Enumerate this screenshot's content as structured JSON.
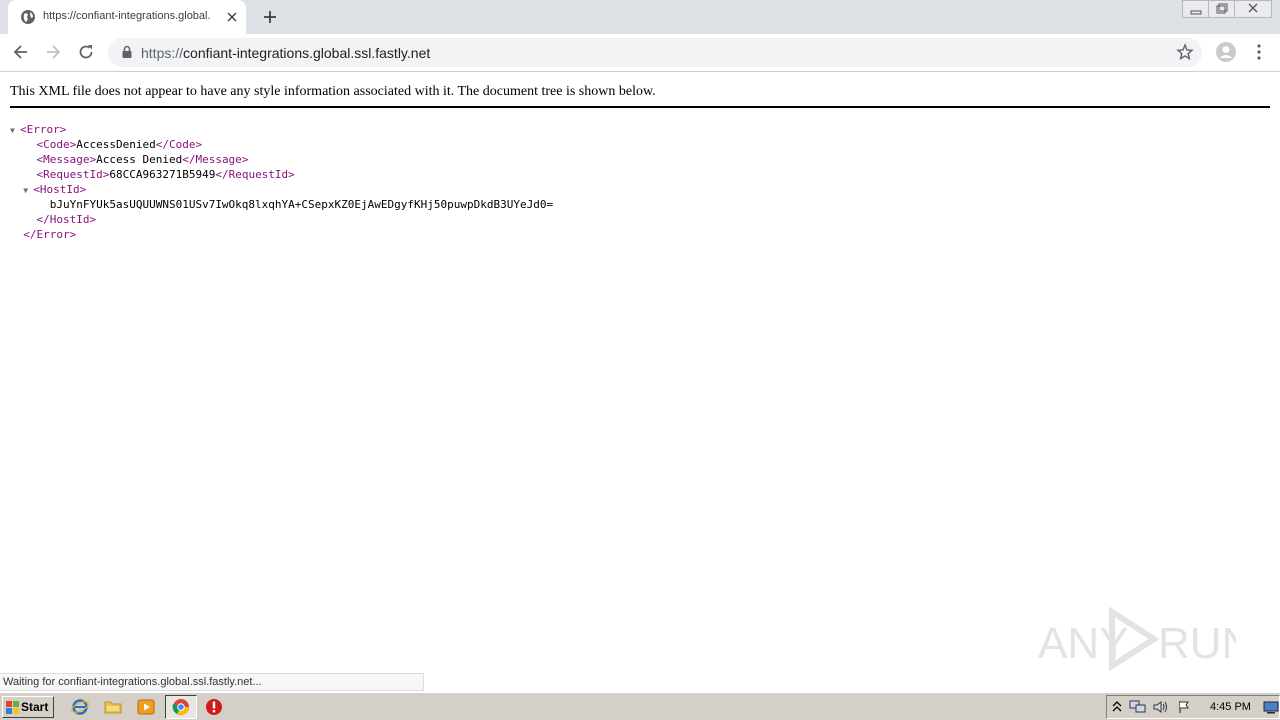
{
  "browser": {
    "tab_title": "https://confiant-integrations.global.",
    "url_scheme": "https://",
    "url_host": "confiant-integrations.global.ssl.fastly.net",
    "status": "Waiting for confiant-integrations.global.ssl.fastly.net..."
  },
  "page": {
    "info": "This XML file does not appear to have any style information associated with it. The document tree is shown below.",
    "error_open": "<Error>",
    "error_close": "</Error>",
    "code_open": "<Code>",
    "code_value": "AccessDenied",
    "code_close": "</Code>",
    "message_open": "<Message>",
    "message_value": "Access Denied",
    "message_close": "</Message>",
    "requestid_open": "<RequestId>",
    "requestid_value": "68CCA963271B5949",
    "requestid_close": "</RequestId>",
    "hostid_open": "<HostId>",
    "hostid_value": "bJuYnFYUk5asUQUUWNS01USv7IwOkq8lxqhYA+CSepxKZ0EjAwEDgyfKHj50puwpDkdB3UYeJd0=",
    "hostid_close": "</HostId>"
  },
  "watermark": {
    "text_left": "ANY",
    "text_right": "RUN"
  },
  "taskbar": {
    "start_label": "Start",
    "clock": "4:45 PM"
  },
  "colors": {
    "tab_strip": "#dee1e6",
    "xml_tag": "#881280",
    "taskbar": "#d4d0c8"
  }
}
